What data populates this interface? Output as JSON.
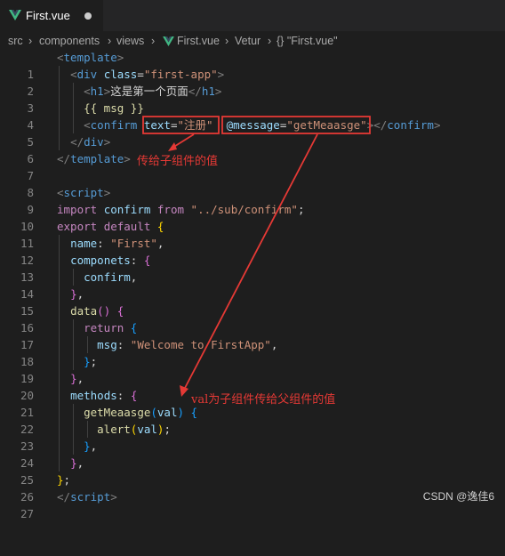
{
  "tab": {
    "label": "First.vue"
  },
  "breadcrumb": [
    "src",
    "components",
    "views",
    "First.vue",
    "Vetur",
    "{} \"First.vue\""
  ],
  "lines": [
    {
      "n": "1"
    },
    {
      "n": "2"
    },
    {
      "n": "3"
    },
    {
      "n": "4"
    },
    {
      "n": "5"
    },
    {
      "n": "6"
    },
    {
      "n": "7"
    },
    {
      "n": "8"
    },
    {
      "n": "9"
    },
    {
      "n": "10"
    },
    {
      "n": "11"
    },
    {
      "n": "12"
    },
    {
      "n": "13"
    },
    {
      "n": "14"
    },
    {
      "n": "15"
    },
    {
      "n": "16"
    },
    {
      "n": "17"
    },
    {
      "n": "18"
    },
    {
      "n": "19"
    },
    {
      "n": "20"
    },
    {
      "n": "21"
    },
    {
      "n": "22"
    },
    {
      "n": "23"
    },
    {
      "n": "24"
    },
    {
      "n": "25"
    },
    {
      "n": "26"
    },
    {
      "n": "27"
    }
  ],
  "code": {
    "l1": "<template>",
    "l2_tag": "div",
    "l2_attr": "class",
    "l2_val": "\"first-app\"",
    "l3_tag": "h1",
    "l3_text": "这是第一个页面",
    "l4": "{{ msg }}",
    "l5_tag": "confirm",
    "l5_attr1": "text",
    "l5_val1": "\"注册\"",
    "l5_attr2": "@message",
    "l5_val2": "\"getMeaasge\"",
    "l6_tag": "div",
    "l7_tag": "template",
    "l9_tag": "script",
    "l10_import": "import",
    "l10_name": "confirm",
    "l10_from": "from",
    "l10_path": "\"../sub/confirm\"",
    "l11_export": "export",
    "l11_default": "default",
    "l12_key": "name",
    "l12_val": "\"First\"",
    "l13_key": "componets",
    "l14_val": "confirm",
    "l16_fn": "data",
    "l17_kw": "return",
    "l18_key": "msg",
    "l18_val": "\"Welcome to FirstApp\"",
    "l21_key": "methods",
    "l22_fn": "getMeaasge",
    "l22_param": "val",
    "l23_fn": "alert",
    "l23_param": "val",
    "l27_tag": "script"
  },
  "annotations": {
    "pass_value": "传给子组件的值",
    "val_note": "val为子组件传给父组件的值"
  },
  "watermark": "CSDN @逸佳6",
  "colors": {
    "highlight_box": "#e53935",
    "annotation": "#e53935"
  }
}
